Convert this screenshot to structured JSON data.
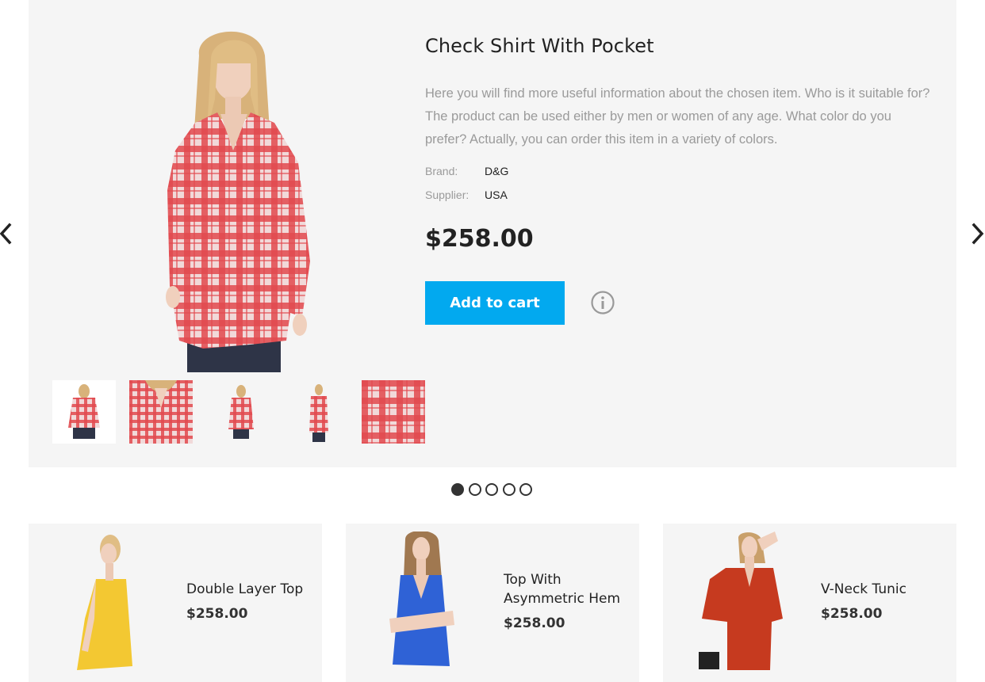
{
  "product": {
    "title": "Check Shirt With Pocket",
    "description": "Here you will find more useful information about the chosen item. Who is it suitable for? The product can be used either by men or women of any age. What color do you prefer? Actually, you can order this item in a variety of colors.",
    "specs": [
      {
        "label": "Brand:",
        "value": "D&G"
      },
      {
        "label": "Supplier:",
        "value": "USA"
      }
    ],
    "price": "$258.00",
    "add_to_cart_label": "Add to cart",
    "thumbnail_count": 5
  },
  "slider": {
    "dot_count": 5,
    "active_index": 0
  },
  "related": [
    {
      "name": "Double Layer Top",
      "price": "$258.00"
    },
    {
      "name": "Top With Asymmetric Hem",
      "price": "$258.00"
    },
    {
      "name": "V-Neck Tunic",
      "price": "$258.00"
    }
  ],
  "colors": {
    "accent": "#02a9ef",
    "panel_bg": "#f5f5f5",
    "muted_text": "#9a9a9a",
    "shirt_red": "#e24a4f",
    "top_yellow": "#f3c832",
    "top_blue": "#2f62d6",
    "tunic_red": "#c63a1f"
  },
  "icons": {
    "prev": "chevron-left-icon",
    "next": "chevron-right-icon",
    "info": "info-circle-icon"
  }
}
